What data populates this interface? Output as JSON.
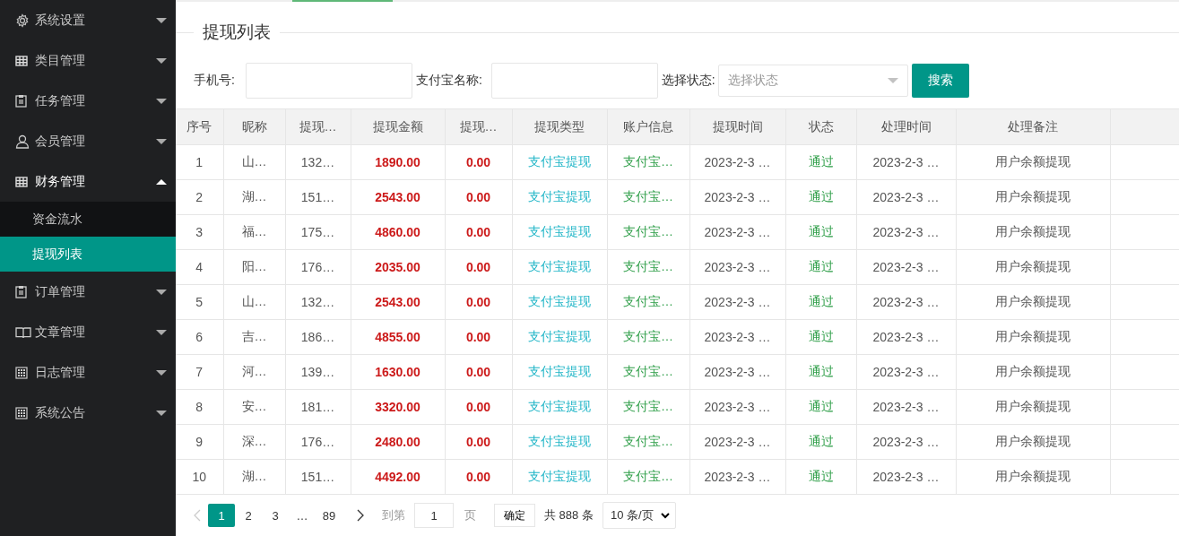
{
  "sidebar": {
    "items": [
      {
        "label": "系统设置",
        "expanded": false
      },
      {
        "label": "类目管理",
        "expanded": false
      },
      {
        "label": "任务管理",
        "expanded": false
      },
      {
        "label": "会员管理",
        "expanded": false
      },
      {
        "label": "财务管理",
        "expanded": true,
        "children": [
          {
            "label": "资金流水",
            "selected": false
          },
          {
            "label": "提现列表",
            "selected": true
          }
        ]
      },
      {
        "label": "订单管理",
        "expanded": false
      },
      {
        "label": "文章管理",
        "expanded": false
      },
      {
        "label": "日志管理",
        "expanded": false
      },
      {
        "label": "系统公告",
        "expanded": false
      }
    ]
  },
  "page_title": "提现列表",
  "filters": {
    "phone_label": "手机号:",
    "alipay_label": "支付宝名称:",
    "status_label": "选择状态:",
    "status_placeholder": "选择状态",
    "search_button": "搜索"
  },
  "table": {
    "columns": [
      {
        "label": "序号",
        "kind": "plain"
      },
      {
        "label": "昵称",
        "kind": "plain"
      },
      {
        "label": "提现…",
        "kind": "plain"
      },
      {
        "label": "提现金额",
        "kind": "amount"
      },
      {
        "label": "提现…",
        "kind": "amount"
      },
      {
        "label": "提现类型",
        "kind": "link"
      },
      {
        "label": "账户信息",
        "kind": "account"
      },
      {
        "label": "提现时间",
        "kind": "plain"
      },
      {
        "label": "状态",
        "kind": "status"
      },
      {
        "label": "处理时间",
        "kind": "plain"
      },
      {
        "label": "处理备注",
        "kind": "plain"
      }
    ],
    "rows": [
      [
        "1",
        "山…",
        "132…",
        "1890.00",
        "0.00",
        "支付宝提现",
        "支付宝…",
        "2023-2-3 …",
        "通过",
        "2023-2-3 …",
        "用户余额提现"
      ],
      [
        "2",
        "湖…",
        "151…",
        "2543.00",
        "0.00",
        "支付宝提现",
        "支付宝…",
        "2023-2-3 …",
        "通过",
        "2023-2-3 …",
        "用户余额提现"
      ],
      [
        "3",
        "福…",
        "175…",
        "4860.00",
        "0.00",
        "支付宝提现",
        "支付宝…",
        "2023-2-3 …",
        "通过",
        "2023-2-3 …",
        "用户余额提现"
      ],
      [
        "4",
        "阳…",
        "176…",
        "2035.00",
        "0.00",
        "支付宝提现",
        "支付宝…",
        "2023-2-3 …",
        "通过",
        "2023-2-3 …",
        "用户余额提现"
      ],
      [
        "5",
        "山…",
        "132…",
        "2543.00",
        "0.00",
        "支付宝提现",
        "支付宝…",
        "2023-2-3 …",
        "通过",
        "2023-2-3 …",
        "用户余额提现"
      ],
      [
        "6",
        "吉…",
        "186…",
        "4855.00",
        "0.00",
        "支付宝提现",
        "支付宝…",
        "2023-2-3 …",
        "通过",
        "2023-2-3 …",
        "用户余额提现"
      ],
      [
        "7",
        "河…",
        "139…",
        "1630.00",
        "0.00",
        "支付宝提现",
        "支付宝…",
        "2023-2-3 …",
        "通过",
        "2023-2-3 …",
        "用户余额提现"
      ],
      [
        "8",
        "安…",
        "181…",
        "3320.00",
        "0.00",
        "支付宝提现",
        "支付宝…",
        "2023-2-3 …",
        "通过",
        "2023-2-3 …",
        "用户余额提现"
      ],
      [
        "9",
        "深…",
        "176…",
        "2480.00",
        "0.00",
        "支付宝提现",
        "支付宝…",
        "2023-2-3 …",
        "通过",
        "2023-2-3 …",
        "用户余额提现"
      ],
      [
        "10",
        "湖…",
        "151…",
        "4492.00",
        "0.00",
        "支付宝提现",
        "支付宝…",
        "2023-2-3 …",
        "通过",
        "2023-2-3 …",
        "用户余额提现"
      ]
    ]
  },
  "pagination": {
    "pages": [
      {
        "label": "1",
        "selected": true
      },
      {
        "label": "2",
        "selected": false
      },
      {
        "label": "3",
        "selected": false
      },
      {
        "label": "…",
        "selected": false
      },
      {
        "label": "89",
        "selected": false
      }
    ],
    "goto_label": "到第",
    "goto_value": "1",
    "page_label": "页",
    "confirm_button": "确定",
    "total": "共 888 条",
    "page_size": "10 条/页"
  }
}
